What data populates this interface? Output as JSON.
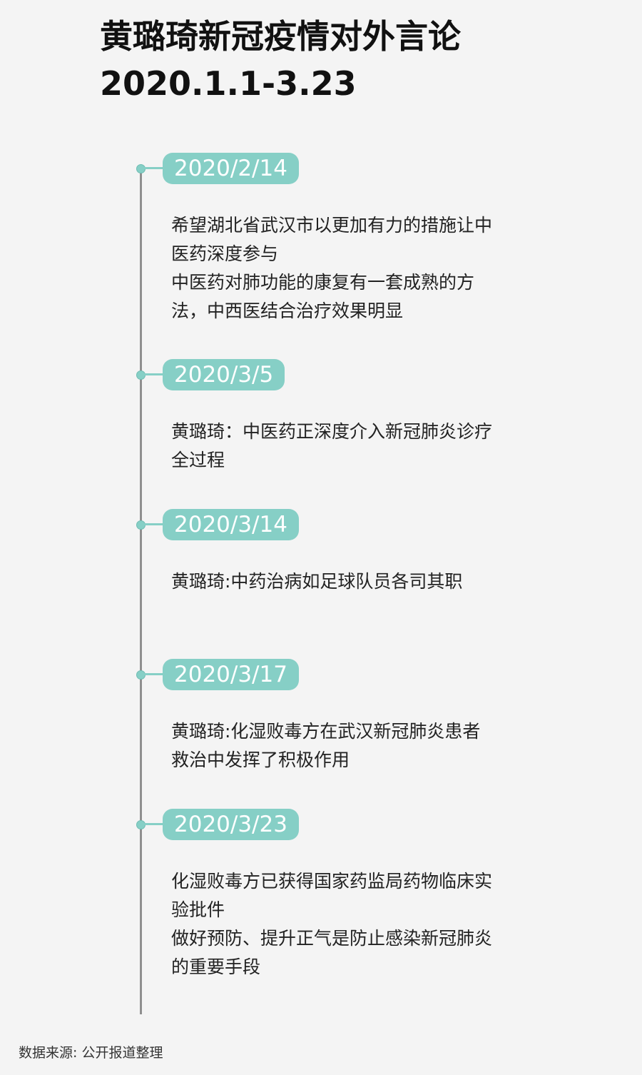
{
  "title": {
    "line1": "黄璐琦新冠疫情对外言论",
    "line2": "2020.1.1-3.23"
  },
  "events": [
    {
      "date": "2020/2/14",
      "lines": [
        "希望湖北省武汉市以更加有力的措施让中医药深度参与",
        "中医药对肺功能的康复有一套成熟的方法，中西医结合治疗效果明显"
      ]
    },
    {
      "date": "2020/3/5",
      "lines": [
        "黄璐琦：中医药正深度介入新冠肺炎诊疗全过程"
      ]
    },
    {
      "date": "2020/3/14",
      "lines": [
        "黄璐琦:中药治病如足球队员各司其职"
      ]
    },
    {
      "date": "2020/3/17",
      "lines": [
        "黄璐琦:化湿败毒方在武汉新冠肺炎患者救治中发挥了积极作用"
      ]
    },
    {
      "date": "2020/3/23",
      "lines": [
        "化湿败毒方已获得国家药监局药物临床实验批件",
        "做好预防、提升正气是防止感染新冠肺炎的重要手段"
      ]
    }
  ],
  "source": "数据来源: 公开报道整理",
  "colors": {
    "accent": "#86cfc6",
    "timeline": "#8f8f8f",
    "background": "#f4f4f4"
  }
}
